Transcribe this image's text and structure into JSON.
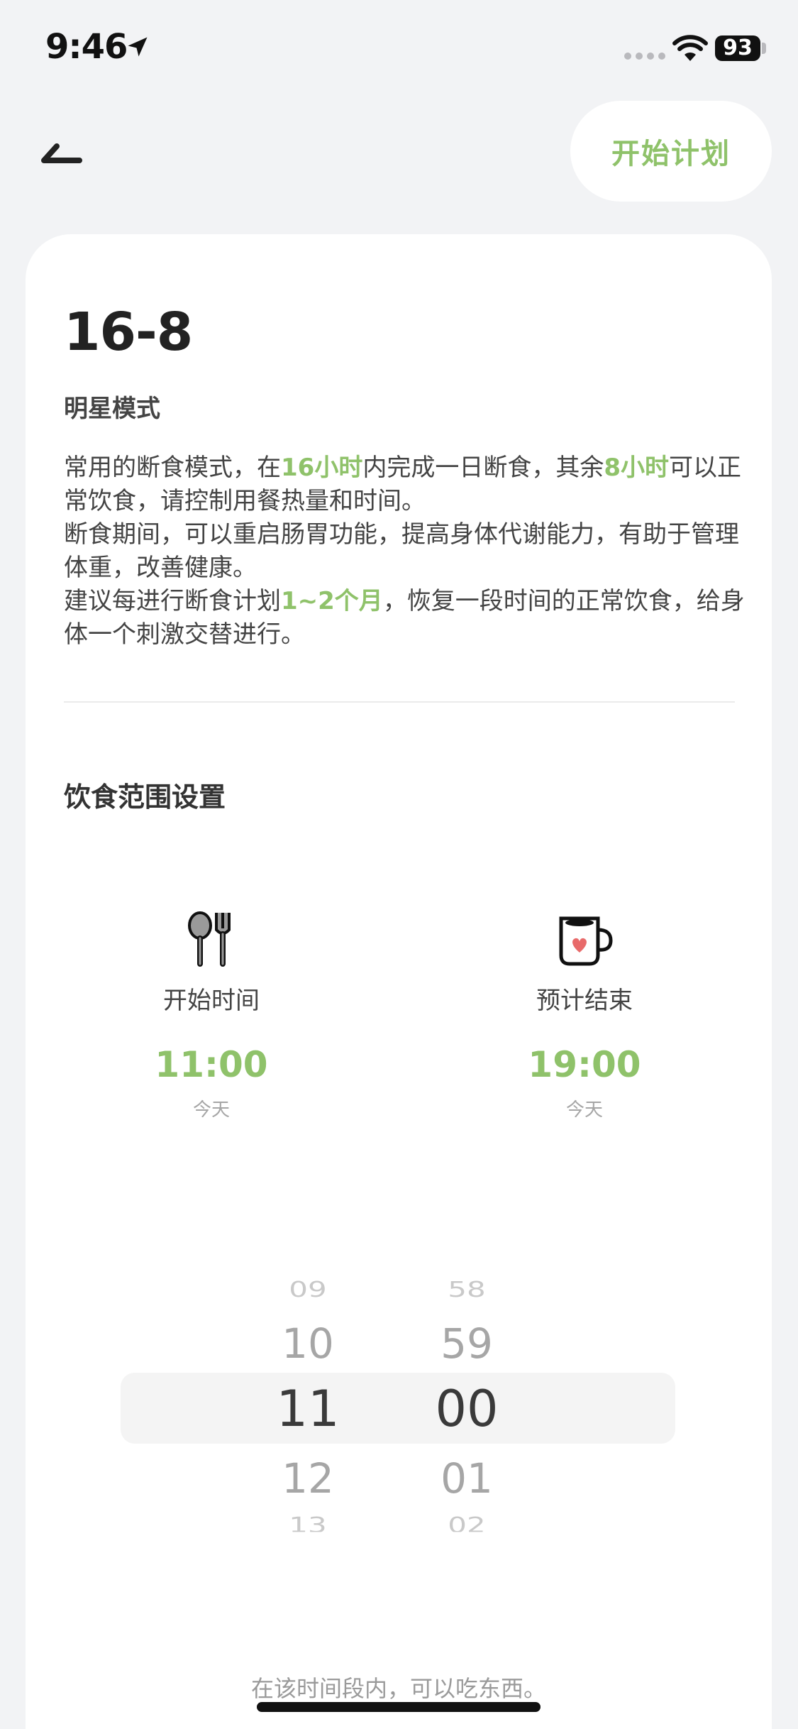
{
  "status_bar": {
    "time": "9:46",
    "battery": "93"
  },
  "header": {
    "start_plan_label": "开始计划"
  },
  "plan": {
    "title": "16-8",
    "subtitle": "明星模式",
    "description": {
      "p1_a": "常用的断食模式，在",
      "p1_hl1": "16小时",
      "p1_b": "内完成一日断食，其余",
      "p1_hl2": "8小时",
      "p1_c": "可以正常饮食，请控制用餐热量和时间。",
      "p2": "断食期间，可以重启肠胃功能，提高身体代谢能力，有助于管理体重，改善健康。",
      "p3_a": "建议每进行断食计划",
      "p3_hl": "1~2个月",
      "p3_b": "，恢复一段时间的正常饮食，给身体一个刺激交替进行。"
    }
  },
  "eating_window": {
    "section_title": "饮食范围设置",
    "start": {
      "label": "开始时间",
      "time": "11:00",
      "day": "今天",
      "icon": "fork-spoon-icon"
    },
    "end": {
      "label": "预计结束",
      "time": "19:00",
      "day": "今天",
      "icon": "coffee-mug-icon"
    }
  },
  "picker": {
    "hours": [
      "09",
      "10",
      "11",
      "12",
      "13"
    ],
    "minutes": [
      "58",
      "59",
      "00",
      "01",
      "02"
    ]
  },
  "footnote": "在该时间段内，可以吃东西。",
  "colors": {
    "accent": "#8fc26a",
    "background": "#f2f3f5",
    "card": "#ffffff"
  }
}
